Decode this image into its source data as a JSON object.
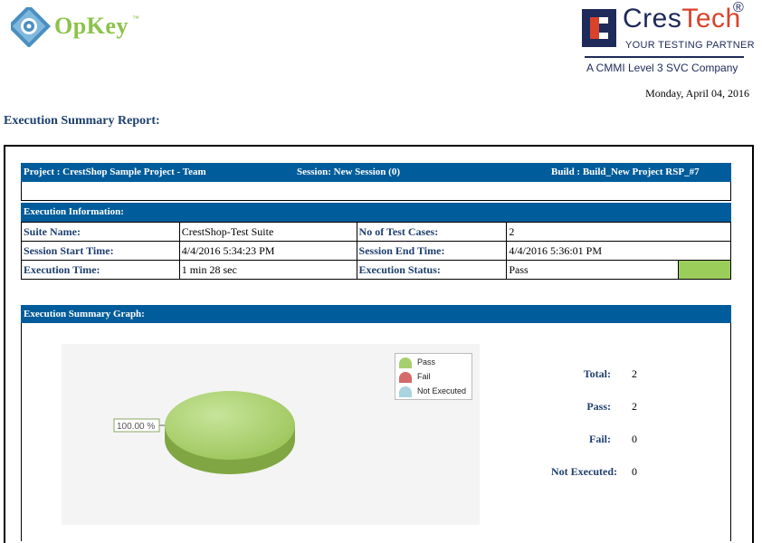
{
  "header": {
    "opkey_logo_text": "OpKey",
    "opkey_tm": "™",
    "crestech_name_a": "Cres",
    "crestech_name_b": "Tech",
    "crestech_reg": "®",
    "crestech_tagline": "YOUR TESTING PARTNER",
    "crestech_cmmi": "A CMMI Level 3 SVC Company",
    "date": "Monday, April 04, 2016"
  },
  "report": {
    "title": "Execution Summary Report:",
    "project": "Project : CrestShop Sample Project - Team",
    "session": "Session:     New Session (0)",
    "build": "Build : Build_New Project RSP_#7",
    "execution_information_heading": "Execution Information:"
  },
  "info": {
    "suite_name_label": "Suite Name:",
    "suite_name": "CrestShop-Test Suite",
    "test_cases_label": "No of  Test Cases:",
    "test_cases": "2",
    "start_label": "Session Start Time:",
    "start": "4/4/2016 5:34:23 PM",
    "end_label": "Session End Time:",
    "end": "4/4/2016 5:36:01 PM",
    "exec_time_label": "Execution Time:",
    "exec_time": "1 min 28 sec",
    "status_label": "Execution Status:",
    "status": "Pass"
  },
  "graph": {
    "heading": "Execution  Summary Graph:",
    "data_label": "100.00 %",
    "legend": [
      {
        "label": "Pass",
        "color": "#a8cf6e"
      },
      {
        "label": "Fail",
        "color": "#d46a6a"
      },
      {
        "label": "Not Executed",
        "color": "#a9d4e0"
      }
    ]
  },
  "stats": {
    "total_label": "Total:",
    "total": "2",
    "pass_label": "Pass:",
    "pass": "2",
    "fail_label": "Fail:",
    "fail": "0",
    "not_executed_label": "Not Executed:",
    "not_executed": "0"
  },
  "chart_data": {
    "type": "pie",
    "categories": [
      "Pass",
      "Fail",
      "Not Executed"
    ],
    "values": [
      2,
      0,
      0
    ],
    "labels": [
      "100.00 %"
    ]
  }
}
